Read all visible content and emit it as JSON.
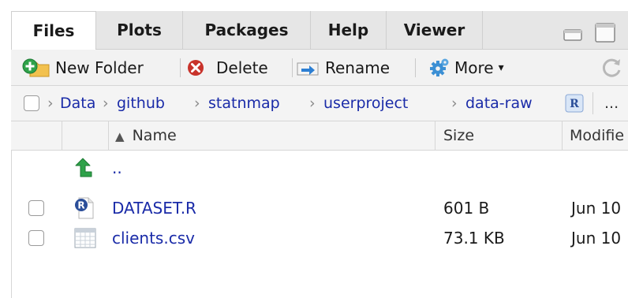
{
  "tabs": [
    {
      "label": "Files",
      "active": true
    },
    {
      "label": "Plots"
    },
    {
      "label": "Packages"
    },
    {
      "label": "Help"
    },
    {
      "label": "Viewer"
    }
  ],
  "toolbar": {
    "new_folder": "New Folder",
    "delete": "Delete",
    "rename": "Rename",
    "more": "More",
    "more_caret": "▾"
  },
  "breadcrumb": {
    "items": [
      "Data",
      "github",
      "statnmap",
      "userproject",
      "data-raw"
    ],
    "separator": "›",
    "overflow": "..."
  },
  "columns": {
    "name": "Name",
    "sort_indicator": "▲",
    "size": "Size",
    "modified": "Modifie"
  },
  "parent_dir": "..",
  "files": [
    {
      "name": "DATASET.R",
      "size": "601 B",
      "modified": "Jun 10",
      "icon": "r-file-icon"
    },
    {
      "name": "clients.csv",
      "size": "73.1 KB",
      "modified": "Jun 10",
      "icon": "csv-file-icon"
    }
  ],
  "colors": {
    "link": "#1a2ba8",
    "green_arrow": "#2fa24a",
    "delete_red": "#c8332b",
    "gear_blue": "#3b8fd4"
  }
}
